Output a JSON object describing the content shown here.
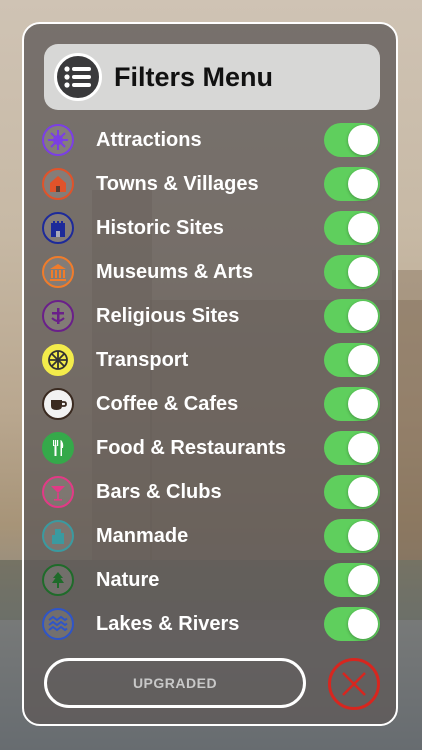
{
  "header": {
    "title": "Filters Menu"
  },
  "filters": [
    {
      "label": "Attractions",
      "icon": "attractions-icon",
      "color": "#7b3fe4",
      "on": true
    },
    {
      "label": "Towns & Villages",
      "icon": "house-icon",
      "color": "#e0532a",
      "on": true
    },
    {
      "label": "Historic Sites",
      "icon": "castle-icon",
      "color": "#1d2a9a",
      "on": true
    },
    {
      "label": "Museums & Arts",
      "icon": "museum-icon",
      "color": "#f07c2b",
      "on": true
    },
    {
      "label": "Religious Sites",
      "icon": "cross-icon",
      "color": "#6a1f8a",
      "on": true
    },
    {
      "label": "Transport",
      "icon": "wheel-icon",
      "color": "#f3ec4b",
      "on": true
    },
    {
      "label": "Coffee & Cafes",
      "icon": "coffee-cup-icon",
      "color": "#3a2a20",
      "on": true
    },
    {
      "label": "Food & Restaurants",
      "icon": "cutlery-icon",
      "color": "#35a94a",
      "on": true
    },
    {
      "label": "Bars & Clubs",
      "icon": "cocktail-icon",
      "color": "#e23a86",
      "on": true
    },
    {
      "label": "Manmade",
      "icon": "building-icon",
      "color": "#3a9aa0",
      "on": true
    },
    {
      "label": "Nature",
      "icon": "tree-icon",
      "color": "#1f6b2a",
      "on": true
    },
    {
      "label": "Lakes & Rivers",
      "icon": "waves-icon",
      "color": "#2f55c8",
      "on": true
    }
  ],
  "footer": {
    "upgrade_label": "UPGRADED",
    "close_color": "#d7261f"
  }
}
